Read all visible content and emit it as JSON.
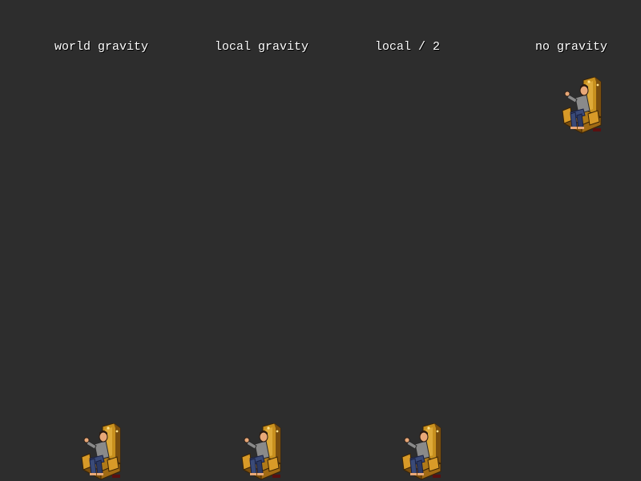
{
  "scene": {
    "background": "#2d2d2d",
    "label_color": "#ffffff",
    "columns": [
      {
        "label": "world gravity",
        "sprite": "throne-sprite"
      },
      {
        "label": "local gravity",
        "sprite": "throne-sprite"
      },
      {
        "label": "local / 2",
        "sprite": "throne-sprite"
      },
      {
        "label": "no gravity",
        "sprite": "throne-sprite"
      }
    ]
  },
  "palette": {
    "chair_gold": "#c8901e",
    "chair_dark": "#7a4e0e",
    "chair_highlight": "#f0c050",
    "shirt": "#8a8a8a",
    "pants": "#3a4a78",
    "skin": "#e8a878",
    "hair": "#2a1a10",
    "base": "#5a1010"
  }
}
